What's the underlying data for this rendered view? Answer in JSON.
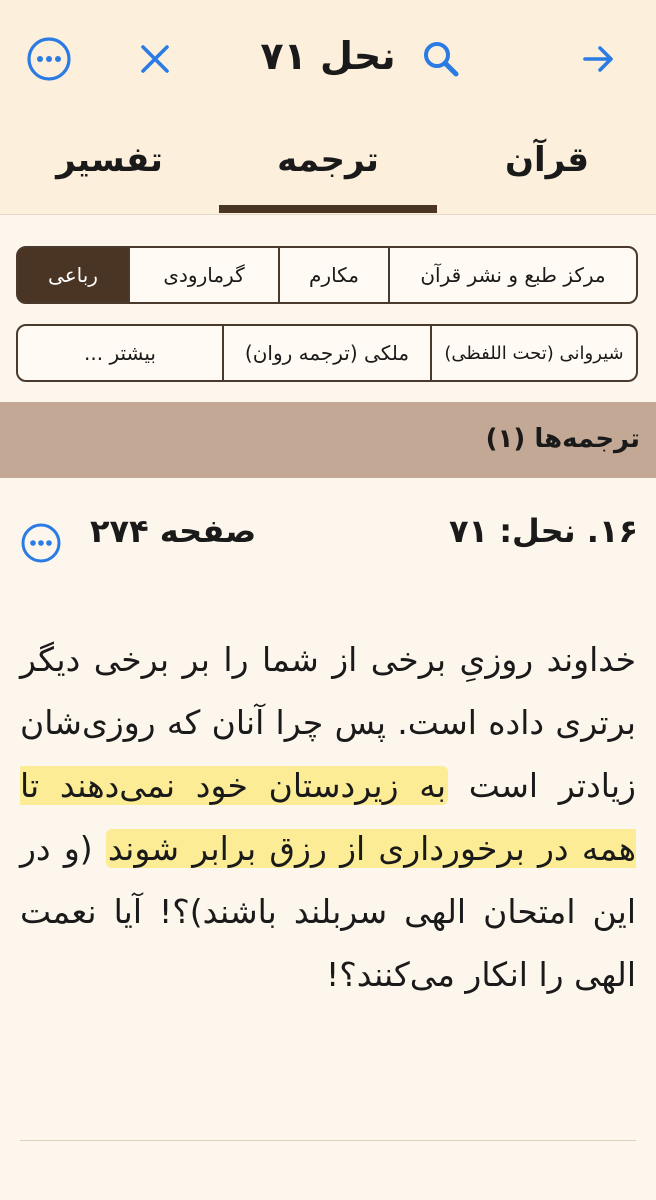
{
  "header": {
    "title": "نحل ۷۱",
    "icons": {
      "forward": "arrow-right-icon",
      "search": "search-icon",
      "close": "close-icon",
      "more": "more-horizontal-icon"
    },
    "accent_color": "#2a7be4"
  },
  "tabs": [
    {
      "label": "قرآن",
      "selected": false
    },
    {
      "label": "ترجمه",
      "selected": true
    },
    {
      "label": "تفسیر",
      "selected": false
    }
  ],
  "translators": {
    "row1": [
      "مرکز طبع و نشر قرآن",
      "مکارم",
      "گرمارودی",
      "رباعی"
    ],
    "row1_selected": "رباعی",
    "row2": [
      "شیروانی (تحت اللفظی)",
      "ملکی (ترجمه روان)",
      "بیشتر ..."
    ]
  },
  "section": {
    "label": "ترجمه‌ها (۱)"
  },
  "verse": {
    "reference": "۱۶. نحل: ۷۱",
    "page": "صفحه ۲۷۴",
    "text_before": "خداوند روزیِ برخی از شما را بر برخی دیگر برتری داده است. پس چرا آنان که روزی‌شان زیادتر است ",
    "text_highlighted": "به زیردستان خود نمی‌دهند تا همه در برخورداری از رزق برابر شوند",
    "text_after": " (و در این امتحان الهی سربلند باشند)؟! آیا نعمت الهی را انکار می‌کنند؟!"
  }
}
